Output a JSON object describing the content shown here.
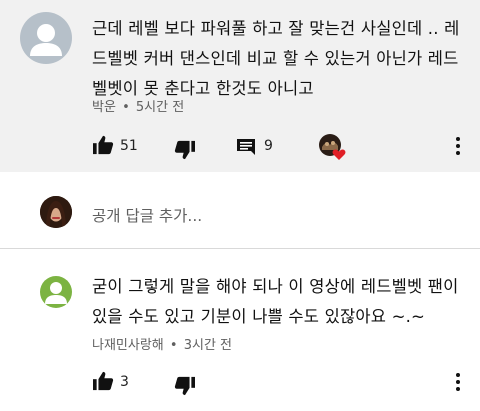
{
  "comments": [
    {
      "text": "근데 레벨 보다 파워풀 하고 잘 맞는건 사실인데 .. 레드벨벳 커버 댄스인데 비교 할 수 있는거 아닌가 레드벨벳이 못 춘다고 한것도 아니고",
      "text_lines": [
        "근데 레벨 보다 파워풀 하고 잘 맞는건 사실인데 .. 레",
        "드벨벳 커버 댄스인데 비교 할 수 있는거 아닌가 레드",
        "벨벳이 못 춘다고 한것도 아니고"
      ],
      "author": "박운",
      "time": "5시간 전",
      "likes": "51",
      "replies": "9",
      "icons": [
        "thumb-up-icon",
        "thumb-down-icon",
        "comment-icon",
        "creator-heart-icon",
        "more-vert-icon"
      ]
    },
    {
      "text": "굳이 그렇게 말을 해야 되나 이 영상에 레드벨벳 팬이 있을 수도 있고 기분이 나쁠 수도 있잖아요 ~.~",
      "text_lines": [
        "굳이 그렇게 말을 해야 되나 이 영상에 레드벨벳 팬이",
        "있을 수도 있고 기분이 나쁠 수도 있잖아요 ~.~"
      ],
      "author": "나재민사랑해",
      "time": "3시간 전",
      "likes": "3",
      "icons": [
        "thumb-up-icon",
        "thumb-down-icon",
        "more-vert-icon"
      ]
    }
  ],
  "reply_box": {
    "placeholder": "공개 답글 추가..."
  },
  "separator": "•",
  "colors": {
    "highlight_bg": "#f1f1f1",
    "meta_gray": "#606060",
    "heart_red": "#e01e26",
    "default_avatar_bg": "#b6c0c9",
    "green_avatar_bg": "#7cb342"
  }
}
